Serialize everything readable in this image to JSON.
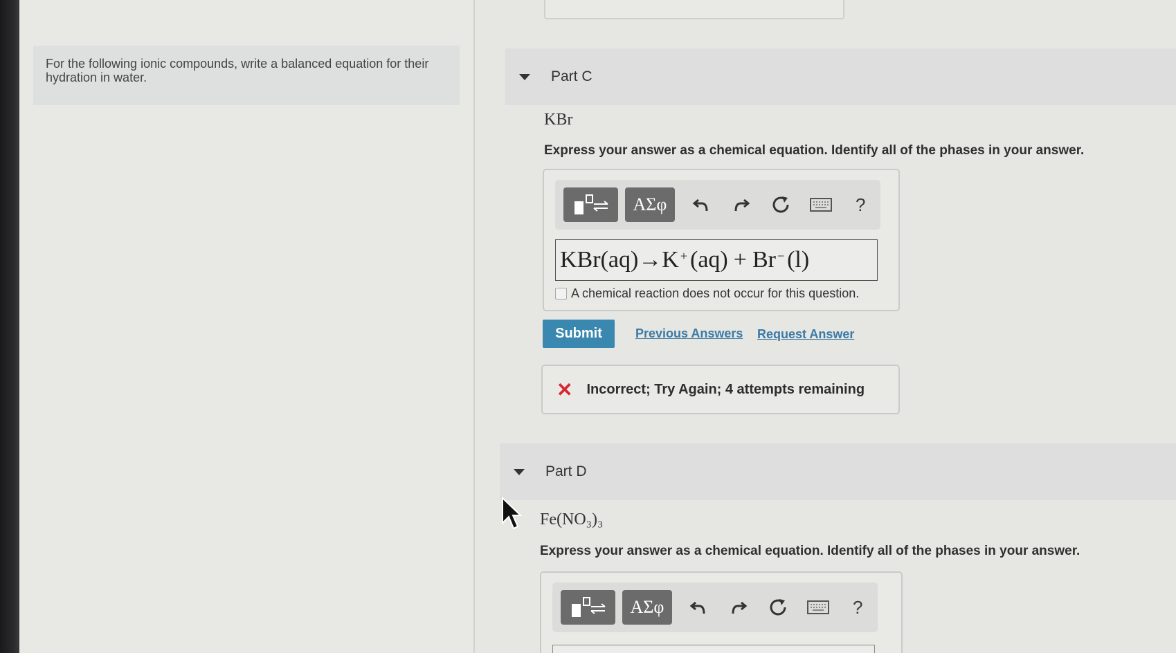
{
  "intro": {
    "text": "For the following ionic compounds, write a balanced equation for their hydration in water."
  },
  "part_c": {
    "label": "Part C",
    "formula": "KBr",
    "instruction": "Express your answer as a chemical equation. Identify all of the phases in your answer.",
    "toolbar": {
      "greek_label": "ΑΣφ",
      "help_label": "?"
    },
    "answer": {
      "reactant": "KBr(aq)",
      "arrow": "→",
      "cation": "K",
      "cation_charge": "+",
      "cation_phase": "(aq)",
      "plus": "+",
      "anion": "Br",
      "anion_charge": "−",
      "anion_phase": "(l)"
    },
    "no_reaction_label": "A chemical reaction does not occur for this question.",
    "submit_label": "Submit",
    "previous_answers_label": "Previous Answers",
    "request_answer_label": "Request Answer",
    "feedback": "Incorrect; Try Again; 4 attempts remaining"
  },
  "part_d": {
    "label": "Part D",
    "formula": "Fe(NO₃)₃",
    "instruction": "Express your answer as a chemical equation. Identify all of the phases in your answer.",
    "toolbar": {
      "greek_label": "ΑΣφ",
      "help_label": "?"
    }
  }
}
